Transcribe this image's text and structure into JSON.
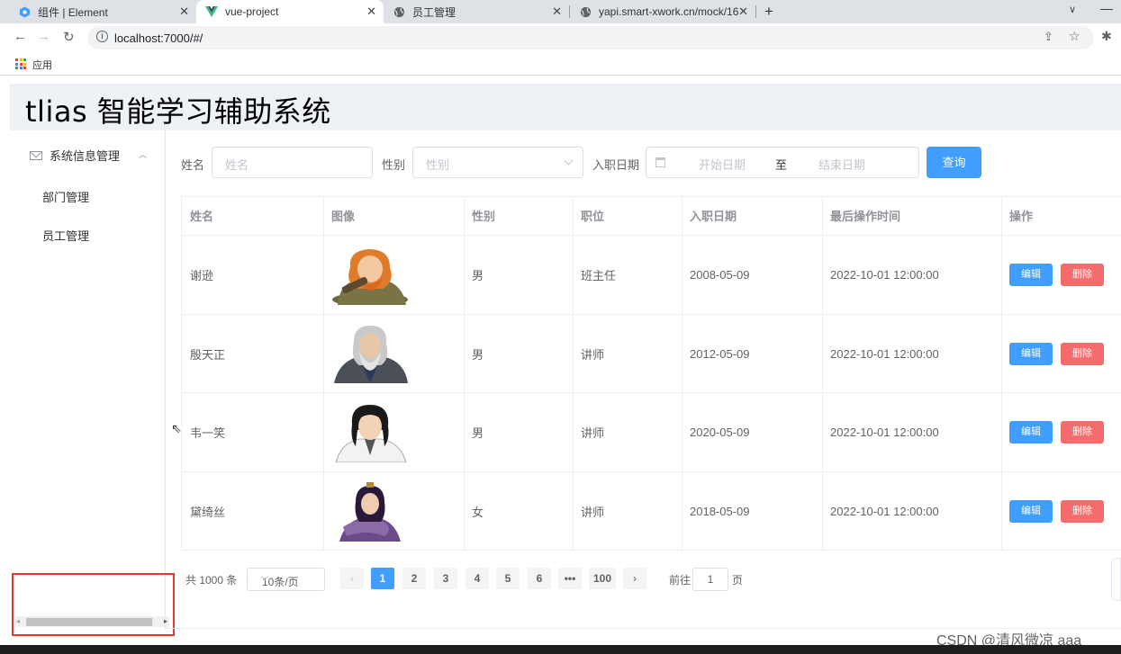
{
  "browser": {
    "tabs": [
      {
        "title": "组件 | Element",
        "icon": "element-logo-icon"
      },
      {
        "title": "vue-project",
        "icon": "vue-logo-icon"
      },
      {
        "title": "员工管理",
        "icon": "globe-icon"
      },
      {
        "title": "yapi.smart-xwork.cn/mock/16",
        "icon": "globe-icon"
      }
    ],
    "url": "localhost:7000/#/",
    "bookmark_label": "应用"
  },
  "app": {
    "title": "tlias 智能学习辅助系统",
    "menu": {
      "group_label": "系统信息管理",
      "items": [
        "部门管理",
        "员工管理"
      ]
    },
    "search": {
      "name_label": "姓名",
      "name_placeholder": "姓名",
      "gender_label": "性别",
      "gender_placeholder": "性别",
      "date_label": "入职日期",
      "start_placeholder": "开始日期",
      "range_separator": "至",
      "end_placeholder": "结束日期",
      "query_button": "查询"
    },
    "table": {
      "headers": [
        "姓名",
        "图像",
        "性别",
        "职位",
        "入职日期",
        "最后操作时间",
        "操作"
      ],
      "rows": [
        {
          "name": "谢逊",
          "gender": "男",
          "job": "班主任",
          "entry_date": "2008-05-09",
          "update_time": "2022-10-01 12:00:00"
        },
        {
          "name": "殷天正",
          "gender": "男",
          "job": "讲师",
          "entry_date": "2012-05-09",
          "update_time": "2022-10-01 12:00:00"
        },
        {
          "name": "韦一笑",
          "gender": "男",
          "job": "讲师",
          "entry_date": "2020-05-09",
          "update_time": "2022-10-01 12:00:00"
        },
        {
          "name": "黛绮丝",
          "gender": "女",
          "job": "讲师",
          "entry_date": "2018-05-09",
          "update_time": "2022-10-01 12:00:00"
        }
      ],
      "edit_label": "编辑",
      "delete_label": "删除"
    },
    "pagination": {
      "total_text": "共 1000 条",
      "page_size": "10条/页",
      "pages": [
        "1",
        "2",
        "3",
        "4",
        "5",
        "6",
        "•••",
        "100"
      ],
      "current_page": "1",
      "goto_label": "前往",
      "goto_value": "1",
      "page_suffix": "页"
    }
  },
  "watermark": "CSDN @清风微凉 aaa",
  "colors": {
    "primary": "#409eff",
    "danger": "#f56c6c",
    "header_bg": "#eef1f6"
  }
}
